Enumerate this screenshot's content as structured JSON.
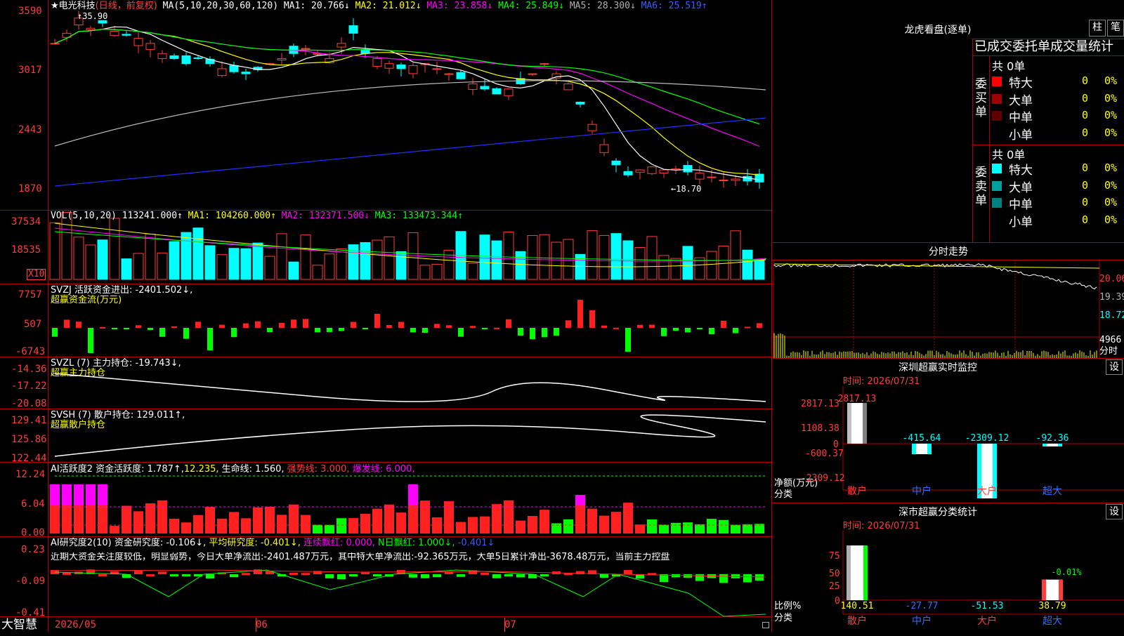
{
  "stock": {
    "star": "★",
    "name": "电光科技",
    "mode": "(日线，前复权)"
  },
  "main_chart": {
    "ma_label": "MA(5,10,20,30,60,120)",
    "ma1": "MA1: 20.766↓",
    "ma2": "MA2: 21.012↓",
    "ma3": "MA3: 23.858↓",
    "ma4": "MA4: 25.849↓",
    "ma5": "MA5: 28.300↓",
    "ma6": "MA6: 25.519↑",
    "high_mark": "↑35.90",
    "low_mark": "←18.70",
    "y_ticks": [
      "3590",
      "3017",
      "2443",
      "1870"
    ]
  },
  "volume_pane": {
    "label": "VOL(5,10,20)",
    "vol": "113241.000↑",
    "ma1": "MA1: 104260.000↑",
    "ma2": "MA2: 132371.500↓",
    "ma3": "MA3: 133473.344↑",
    "y_ticks": [
      "37534",
      "18535"
    ],
    "unit": "X10"
  },
  "svzj_pane": {
    "label": "SVZJ  活跃资金进出: -2401.502↓,",
    "sub": "超赢资金流(万元)",
    "y_ticks": [
      "7757",
      "507",
      "-6743"
    ]
  },
  "svzl_pane": {
    "label": "SVZL (7) 主力持仓: -19.743↓,",
    "sub": "超赢主力持仓",
    "y_ticks": [
      "-14.36",
      "-17.22",
      "-20.08"
    ]
  },
  "svsh_pane": {
    "label": "SVSH (7) 散户持仓: 129.011↑,",
    "sub": "超赢散户持仓",
    "y_ticks": [
      "129.41",
      "125.86",
      "122.44"
    ]
  },
  "ai_active_pane": {
    "label": "AI活跃度2 资金活跃度: 1.787↑,",
    "v2": "12.235,",
    "v3": "生命线: 1.560,",
    "v4": "强势线: 3.000,",
    "v5": "爆发线: 6.000,",
    "y_ticks": [
      "12.24",
      "6.04",
      "0.00"
    ]
  },
  "ai_research_pane": {
    "label": "AI研究度2(10) 资金研究度: -0.106↓,",
    "v2": "平均研究度: -0.401↓,",
    "v3": "连续飘红: 0.000,",
    "v4": "N日飘红: 1.000↓,",
    "v5": "-0.401↓",
    "comment": "近期大资金关注度较低，明显弱势，今日大单净流出:-2401.487万元，其中特大单净流出:-92.365万元，大单5日累计净出-3678.48万元，当前主力控盘",
    "y_ticks": [
      "0.23",
      "-0.09",
      "-0.41"
    ]
  },
  "x_axis": {
    "labels": [
      "2026/05",
      "06",
      "07"
    ]
  },
  "brand": "大智慧",
  "tiger": {
    "title": "龙虎看盘(逐单)",
    "btn_bar": "柱",
    "btn_pen": "笔",
    "header": "已成交委托单成交量统计",
    "buy": {
      "side": "委买单",
      "total": "共 0单",
      "rows": [
        {
          "label": "特大",
          "count": "0",
          "pct": "0%",
          "color": "#ff0000"
        },
        {
          "label": "大单",
          "count": "0",
          "pct": "0%",
          "color": "#a00000"
        },
        {
          "label": "中单",
          "count": "0",
          "pct": "0%",
          "color": "#600000"
        },
        {
          "label": "小单",
          "count": "0",
          "pct": "0%",
          "color": "#000000"
        }
      ]
    },
    "sell": {
      "side": "委卖单",
      "total": "共 0单",
      "rows": [
        {
          "label": "特大",
          "count": "0",
          "pct": "0%",
          "color": "#00ffff"
        },
        {
          "label": "大单",
          "count": "0",
          "pct": "0%",
          "color": "#00a0a0"
        },
        {
          "label": "中单",
          "count": "0",
          "pct": "0%",
          "color": "#008080"
        },
        {
          "label": "小单",
          "count": "0",
          "pct": "0%",
          "color": "#000000"
        }
      ]
    }
  },
  "intraday": {
    "title": "分时走势",
    "prices": [
      "20.06",
      "19.39",
      "18.72"
    ],
    "vol": "4966",
    "vol_label": "分时"
  },
  "monitor": {
    "title": "深圳超赢实时监控",
    "btn": "设",
    "time": "时间: 2026/07/31",
    "y_ticks": [
      "2817.13",
      "1108.38",
      "0",
      "-600.37",
      "-2309.12"
    ],
    "y_unit": "净额(万元)",
    "x_unit": "分类",
    "bars": [
      {
        "cat": "散户",
        "value": 2817.13,
        "label": "2817.13"
      },
      {
        "cat": "中户",
        "value": -415.64,
        "label": "-415.64"
      },
      {
        "cat": "大户",
        "value": -2309.12,
        "label": "-2309.12"
      },
      {
        "cat": "超大",
        "value": -92.36,
        "label": "-92.36"
      }
    ]
  },
  "classify": {
    "title": "深市超赢分类统计",
    "btn": "设",
    "time": "时间: 2026/07/31",
    "y_ticks": [
      "75",
      "50",
      "25",
      "0"
    ],
    "y_unit": "比例%",
    "x_unit": "分类",
    "bars": [
      {
        "cat": "散户",
        "value": 140.51,
        "label": "140.51"
      },
      {
        "cat": "中户",
        "value": -27.77,
        "label": "-27.77"
      },
      {
        "cat": "大户",
        "value": -51.53,
        "label": "-51.53"
      },
      {
        "cat": "超大",
        "value": 38.79,
        "label": "38.79",
        "note": "-0.01%"
      }
    ]
  },
  "colors": {
    "up": "#ff3c3c",
    "down": "#00ffff",
    "grid": "#b00000"
  }
}
